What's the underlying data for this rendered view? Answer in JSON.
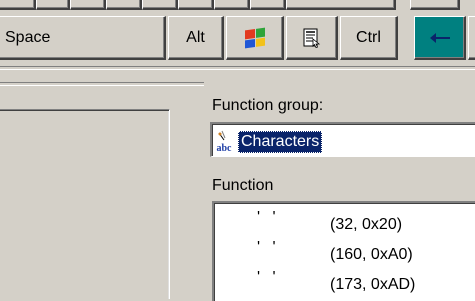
{
  "keyboard": {
    "space_label": "Space",
    "alt_label": "Alt",
    "windows_key_icon": "windows-flag-icon",
    "menu_key_icon": "context-menu-icon",
    "ctrl_label": "Ctrl",
    "backspace_icon": "arrow-left-icon"
  },
  "function_group": {
    "label": "Function group:",
    "label_underlined": "g",
    "icon": "abc-characters-icon",
    "value": "Characters"
  },
  "function": {
    "label": "Function",
    "rows": [
      {
        "glyph": "' '",
        "code": "(32, 0x20)"
      },
      {
        "glyph": "' '",
        "code": "(160, 0xA0)"
      },
      {
        "glyph": "' '",
        "code": "(173, 0xAD)"
      }
    ]
  }
}
